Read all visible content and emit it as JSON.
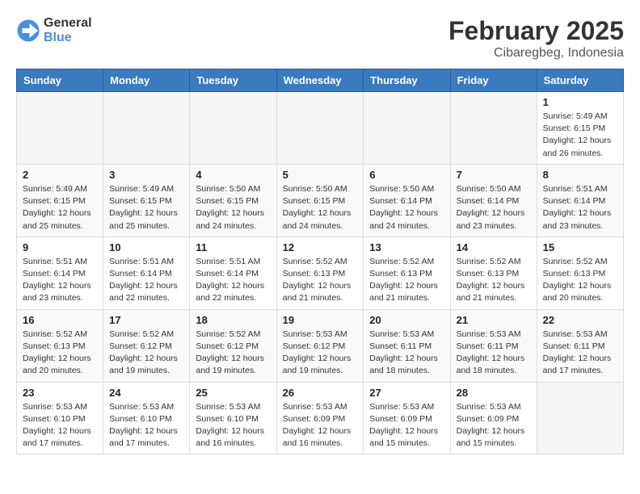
{
  "header": {
    "logo_general": "General",
    "logo_blue": "Blue",
    "title": "February 2025",
    "subtitle": "Cibaregbeg, Indonesia"
  },
  "weekdays": [
    "Sunday",
    "Monday",
    "Tuesday",
    "Wednesday",
    "Thursday",
    "Friday",
    "Saturday"
  ],
  "weeks": [
    [
      {
        "day": "",
        "info": ""
      },
      {
        "day": "",
        "info": ""
      },
      {
        "day": "",
        "info": ""
      },
      {
        "day": "",
        "info": ""
      },
      {
        "day": "",
        "info": ""
      },
      {
        "day": "",
        "info": ""
      },
      {
        "day": "1",
        "info": "Sunrise: 5:49 AM\nSunset: 6:15 PM\nDaylight: 12 hours\nand 26 minutes."
      }
    ],
    [
      {
        "day": "2",
        "info": "Sunrise: 5:49 AM\nSunset: 6:15 PM\nDaylight: 12 hours\nand 25 minutes."
      },
      {
        "day": "3",
        "info": "Sunrise: 5:49 AM\nSunset: 6:15 PM\nDaylight: 12 hours\nand 25 minutes."
      },
      {
        "day": "4",
        "info": "Sunrise: 5:50 AM\nSunset: 6:15 PM\nDaylight: 12 hours\nand 24 minutes."
      },
      {
        "day": "5",
        "info": "Sunrise: 5:50 AM\nSunset: 6:15 PM\nDaylight: 12 hours\nand 24 minutes."
      },
      {
        "day": "6",
        "info": "Sunrise: 5:50 AM\nSunset: 6:14 PM\nDaylight: 12 hours\nand 24 minutes."
      },
      {
        "day": "7",
        "info": "Sunrise: 5:50 AM\nSunset: 6:14 PM\nDaylight: 12 hours\nand 23 minutes."
      },
      {
        "day": "8",
        "info": "Sunrise: 5:51 AM\nSunset: 6:14 PM\nDaylight: 12 hours\nand 23 minutes."
      }
    ],
    [
      {
        "day": "9",
        "info": "Sunrise: 5:51 AM\nSunset: 6:14 PM\nDaylight: 12 hours\nand 23 minutes."
      },
      {
        "day": "10",
        "info": "Sunrise: 5:51 AM\nSunset: 6:14 PM\nDaylight: 12 hours\nand 22 minutes."
      },
      {
        "day": "11",
        "info": "Sunrise: 5:51 AM\nSunset: 6:14 PM\nDaylight: 12 hours\nand 22 minutes."
      },
      {
        "day": "12",
        "info": "Sunrise: 5:52 AM\nSunset: 6:13 PM\nDaylight: 12 hours\nand 21 minutes."
      },
      {
        "day": "13",
        "info": "Sunrise: 5:52 AM\nSunset: 6:13 PM\nDaylight: 12 hours\nand 21 minutes."
      },
      {
        "day": "14",
        "info": "Sunrise: 5:52 AM\nSunset: 6:13 PM\nDaylight: 12 hours\nand 21 minutes."
      },
      {
        "day": "15",
        "info": "Sunrise: 5:52 AM\nSunset: 6:13 PM\nDaylight: 12 hours\nand 20 minutes."
      }
    ],
    [
      {
        "day": "16",
        "info": "Sunrise: 5:52 AM\nSunset: 6:13 PM\nDaylight: 12 hours\nand 20 minutes."
      },
      {
        "day": "17",
        "info": "Sunrise: 5:52 AM\nSunset: 6:12 PM\nDaylight: 12 hours\nand 19 minutes."
      },
      {
        "day": "18",
        "info": "Sunrise: 5:52 AM\nSunset: 6:12 PM\nDaylight: 12 hours\nand 19 minutes."
      },
      {
        "day": "19",
        "info": "Sunrise: 5:53 AM\nSunset: 6:12 PM\nDaylight: 12 hours\nand 19 minutes."
      },
      {
        "day": "20",
        "info": "Sunrise: 5:53 AM\nSunset: 6:11 PM\nDaylight: 12 hours\nand 18 minutes."
      },
      {
        "day": "21",
        "info": "Sunrise: 5:53 AM\nSunset: 6:11 PM\nDaylight: 12 hours\nand 18 minutes."
      },
      {
        "day": "22",
        "info": "Sunrise: 5:53 AM\nSunset: 6:11 PM\nDaylight: 12 hours\nand 17 minutes."
      }
    ],
    [
      {
        "day": "23",
        "info": "Sunrise: 5:53 AM\nSunset: 6:10 PM\nDaylight: 12 hours\nand 17 minutes."
      },
      {
        "day": "24",
        "info": "Sunrise: 5:53 AM\nSunset: 6:10 PM\nDaylight: 12 hours\nand 17 minutes."
      },
      {
        "day": "25",
        "info": "Sunrise: 5:53 AM\nSunset: 6:10 PM\nDaylight: 12 hours\nand 16 minutes."
      },
      {
        "day": "26",
        "info": "Sunrise: 5:53 AM\nSunset: 6:09 PM\nDaylight: 12 hours\nand 16 minutes."
      },
      {
        "day": "27",
        "info": "Sunrise: 5:53 AM\nSunset: 6:09 PM\nDaylight: 12 hours\nand 15 minutes."
      },
      {
        "day": "28",
        "info": "Sunrise: 5:53 AM\nSunset: 6:09 PM\nDaylight: 12 hours\nand 15 minutes."
      },
      {
        "day": "",
        "info": ""
      }
    ]
  ]
}
